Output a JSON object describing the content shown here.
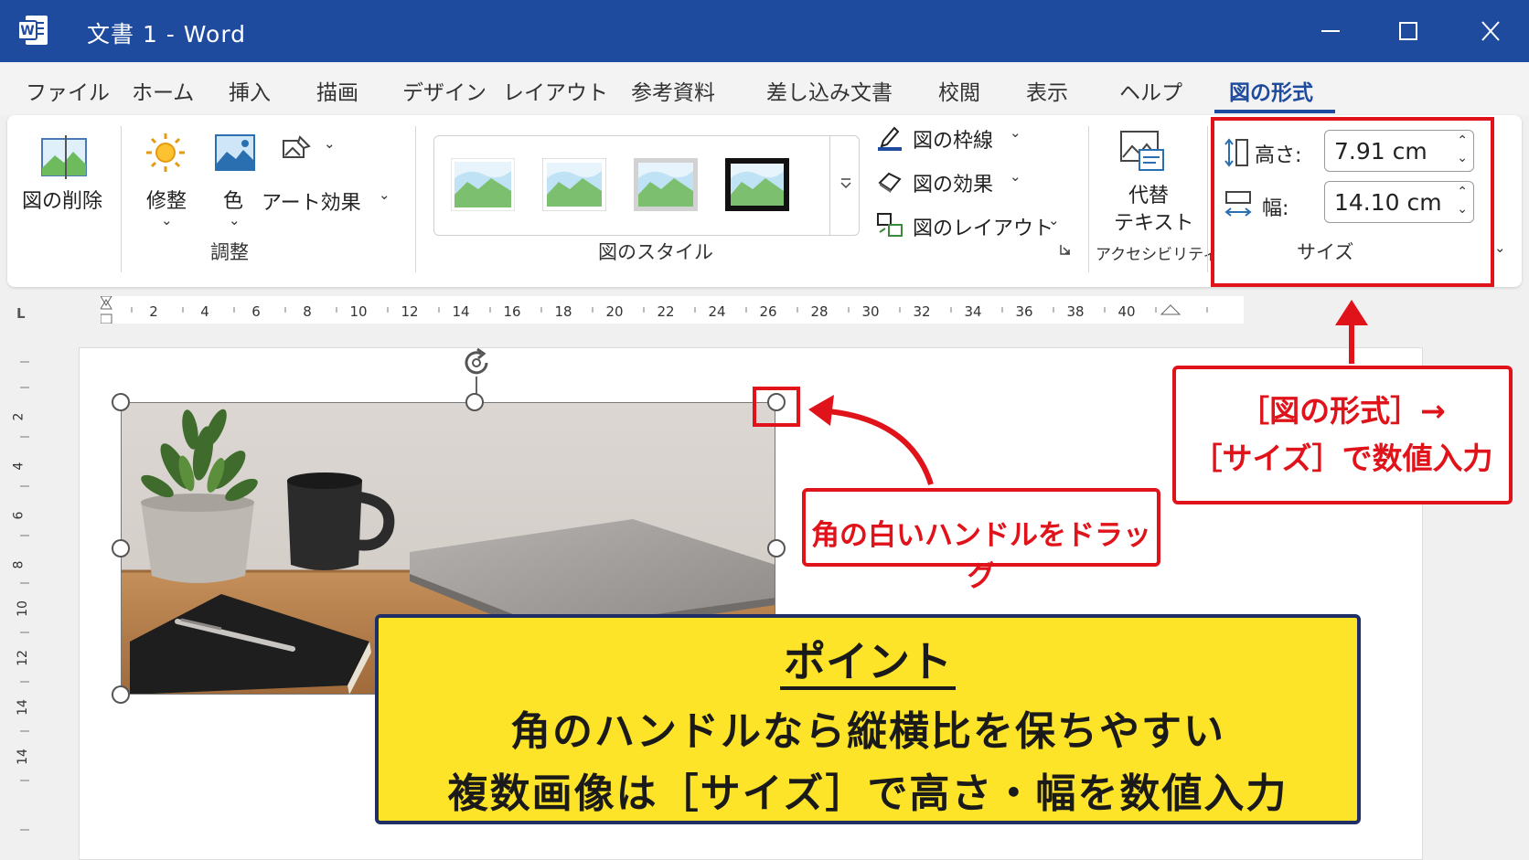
{
  "window": {
    "title": "文書 1 - Word"
  },
  "tabs": [
    "ファイル",
    "ホーム",
    "挿入",
    "描画",
    "デザイン",
    "レイアウト",
    "参考資料",
    "差し込み文書",
    "校閲",
    "表示",
    "ヘルプ",
    "図の形式"
  ],
  "active_tab": "図の形式",
  "ribbon": {
    "remove_bg": "図の削除",
    "corrections": "修整",
    "color": "色",
    "artistic": "アート効果",
    "adjust_group": "調整",
    "styles_group": "図のスタイル",
    "border": "図の枠線",
    "effects": "図の効果",
    "layout": "図のレイアウト",
    "alt_text_1": "代替",
    "alt_text_2": "テキスト",
    "accessibility_group": "アクセシビリティ",
    "height_label": "高さ:",
    "height_value": "7.91 cm",
    "width_label": "幅:",
    "width_value": "14.10 cm",
    "size_group": "サイズ"
  },
  "ruler": {
    "h_ticks": [
      "2",
      "4",
      "6",
      "8",
      "10",
      "12",
      "14",
      "16",
      "18",
      "20",
      "22",
      "24",
      "26",
      "28",
      "30",
      "32",
      "34",
      "36",
      "38",
      "40"
    ],
    "v_ticks": [
      "2",
      "4",
      "6",
      "8",
      "10",
      "12",
      "14",
      "14"
    ]
  },
  "annotations": {
    "drag_callout": "角の白いハンドルをドラッグ",
    "size_callout_1": "［図の形式］→",
    "size_callout_2": "［サイズ］で数値入力"
  },
  "point": {
    "title": "ポイント",
    "line1": "角のハンドルなら縦横比を保ちやすい",
    "line2": "複数画像は［サイズ］で高さ・幅を数値入力"
  },
  "colors": {
    "title_bar": "#1f4b9e",
    "highlight": "#e0121a",
    "point_bg": "#fde428"
  }
}
